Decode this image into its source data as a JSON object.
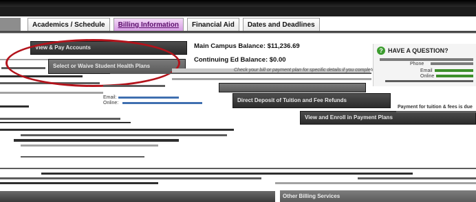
{
  "tabs": [
    {
      "label": "Academics / Schedule"
    },
    {
      "label": "Billing Information"
    },
    {
      "label": "Financial Aid"
    },
    {
      "label": "Dates and Deadlines"
    }
  ],
  "left_menu": {
    "view_pay": "View & Pay Accounts",
    "health_plans": "Select or Waive Student Health Plans"
  },
  "balances": {
    "main_campus": "Main Campus Balance: $11,236.69",
    "continuing": "Continuing Ed Balance: $0.00"
  },
  "notice": "Check your bill or payment plan for specific details if you complete",
  "services": {
    "direct_deposit": "Direct Deposit of Tuition and Fee Refunds",
    "payment_plans": "View and Enroll in Payment Plans",
    "other_billing": "Other Billing Services"
  },
  "question": {
    "title": "HAVE A QUESTION?",
    "phone_label": "Phone",
    "email_label": "Email",
    "online_label": "Online"
  },
  "contact": {
    "email_prefix": "Email:",
    "online_prefix": "Online:"
  },
  "side_note": "Payment for tuition & fees is due",
  "colors": {
    "accent_tab": "#d59be3",
    "highlight_circle": "#b3131b",
    "help_icon": "#3b9c2e"
  }
}
